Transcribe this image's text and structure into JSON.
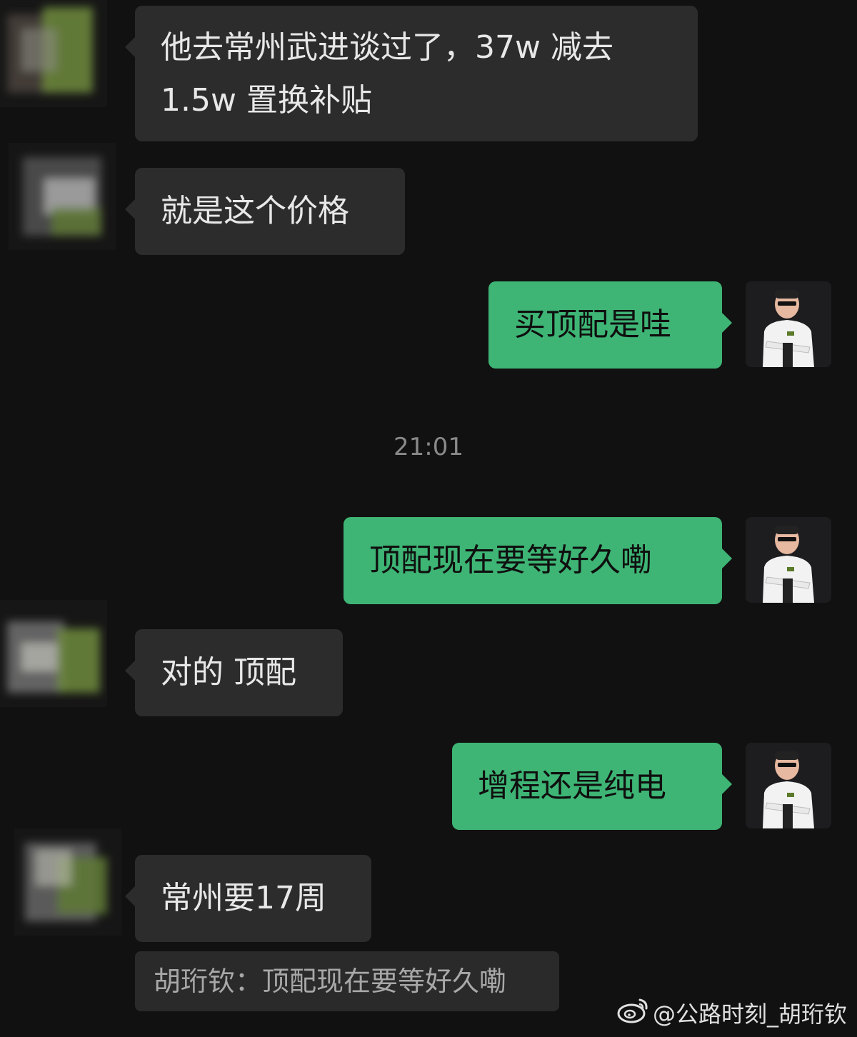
{
  "messages": [
    {
      "side": "in",
      "text_lines": [
        "他去常州武进谈过了，37w 减去",
        "1.5w 置换补贴"
      ]
    },
    {
      "side": "in",
      "text": "就是这个价格"
    },
    {
      "side": "out",
      "text": "买顶配是哇"
    },
    {
      "timestamp": "21:01"
    },
    {
      "side": "out",
      "text": "顶配现在要等好久嘞"
    },
    {
      "side": "in",
      "text": "对的 顶配"
    },
    {
      "side": "out",
      "text": "增程还是纯电"
    },
    {
      "side": "in",
      "text": "常州要17周"
    }
  ],
  "quote": {
    "text": "胡珩钦：顶配现在要等好久嘞"
  },
  "watermark": {
    "text": "@公路时刻_胡珩钦",
    "icon": "weibo-icon"
  },
  "colors": {
    "background": "#111111",
    "incoming_bubble": "#2c2c2c",
    "outgoing_bubble": "#3eb575",
    "timestamp": "#8a8a8a"
  }
}
